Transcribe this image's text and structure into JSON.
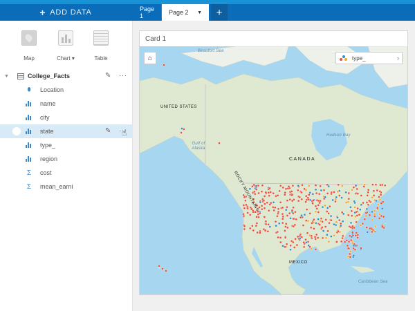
{
  "topbar": {
    "add_data_label": "ADD DATA",
    "tabs": [
      {
        "label": "Page 1",
        "active": false
      },
      {
        "label": "Page 2",
        "active": true
      }
    ],
    "add_tab_symbol": "+"
  },
  "sidebar": {
    "viz_types": [
      {
        "label": "Map",
        "icon": "map-icon"
      },
      {
        "label": "Chart ▾",
        "icon": "chart-icon"
      },
      {
        "label": "Table",
        "icon": "table-icon"
      }
    ],
    "dataset": {
      "name": "College_Facts",
      "more_symbol": "···"
    },
    "fields": [
      {
        "name": "Location",
        "type": "location"
      },
      {
        "name": "name",
        "type": "string"
      },
      {
        "name": "city",
        "type": "string"
      },
      {
        "name": "state",
        "type": "string",
        "selected": true
      },
      {
        "name": "type_",
        "type": "string"
      },
      {
        "name": "region",
        "type": "string"
      },
      {
        "name": "cost",
        "type": "number"
      },
      {
        "name": "mean_earni",
        "type": "number"
      }
    ]
  },
  "card": {
    "title": "Card 1",
    "legend_label": "type_",
    "legend_colors": [
      "#e8523c",
      "#2f8fd0",
      "#f5a623"
    ],
    "map_labels": {
      "beaufort_sea": "Beaufort Sea",
      "united_states": "UNITED STATES",
      "gulf_of_alaska": "Gulf of\nAlaska",
      "rocky_mountains": "ROCKY MOUNTAINS",
      "canada": "CANADA",
      "hudson_bay": "Hudson Bay",
      "mexico": "MEXICO",
      "caribbean_sea": "Caribbean Sea"
    },
    "point_colors": {
      "red": "#e8523c",
      "blue": "#2f8fd0",
      "orange": "#f5a623"
    }
  }
}
